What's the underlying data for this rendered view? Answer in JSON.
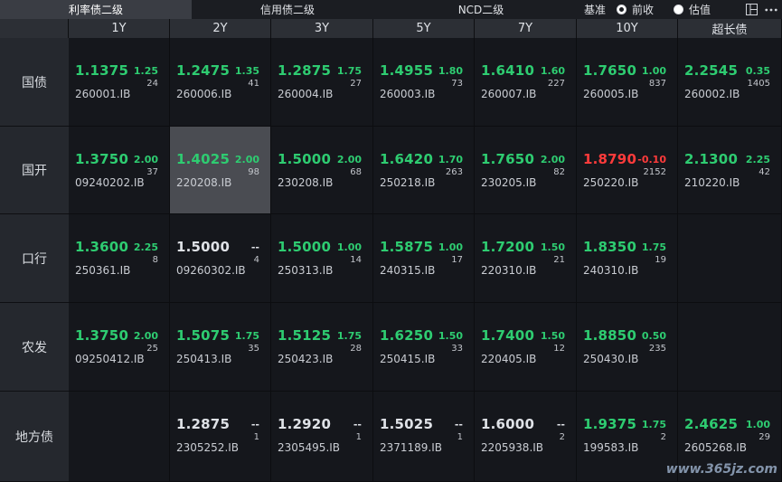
{
  "tabs": [
    {
      "label": "利率债二级",
      "active": true
    },
    {
      "label": "信用债二级",
      "active": false
    },
    {
      "label": "NCD二级",
      "active": false
    }
  ],
  "controls": {
    "base_label": "基准",
    "options": [
      {
        "label": "前收",
        "checked": true
      },
      {
        "label": "估值",
        "checked": false
      }
    ],
    "icons": [
      "layout-icon",
      "more-icon"
    ]
  },
  "columns": [
    "1Y",
    "2Y",
    "3Y",
    "5Y",
    "7Y",
    "10Y",
    "超长债"
  ],
  "rows": [
    {
      "label": "国债",
      "cells": [
        {
          "val": "1.1375",
          "chg": "1.25",
          "vol": "24",
          "code": "260001.IB",
          "color": "green"
        },
        {
          "val": "1.2475",
          "chg": "1.35",
          "vol": "41",
          "code": "260006.IB",
          "color": "green"
        },
        {
          "val": "1.2875",
          "chg": "1.75",
          "vol": "27",
          "code": "260004.IB",
          "color": "green"
        },
        {
          "val": "1.4955",
          "chg": "1.80",
          "vol": "73",
          "code": "260003.IB",
          "color": "green"
        },
        {
          "val": "1.6410",
          "chg": "1.60",
          "vol": "227",
          "code": "260007.IB",
          "color": "green"
        },
        {
          "val": "1.7650",
          "chg": "1.00",
          "vol": "837",
          "code": "260005.IB",
          "color": "green"
        },
        {
          "val": "2.2545",
          "chg": "0.35",
          "vol": "1405",
          "code": "260002.IB",
          "color": "green"
        }
      ]
    },
    {
      "label": "国开",
      "cells": [
        {
          "val": "1.3750",
          "chg": "2.00",
          "vol": "37",
          "code": "09240202.IB",
          "color": "green"
        },
        {
          "val": "1.4025",
          "chg": "2.00",
          "vol": "98",
          "code": "220208.IB",
          "color": "green",
          "selected": true
        },
        {
          "val": "1.5000",
          "chg": "2.00",
          "vol": "68",
          "code": "230208.IB",
          "color": "green"
        },
        {
          "val": "1.6420",
          "chg": "1.70",
          "vol": "263",
          "code": "250218.IB",
          "color": "green"
        },
        {
          "val": "1.7650",
          "chg": "2.00",
          "vol": "82",
          "code": "230205.IB",
          "color": "green"
        },
        {
          "val": "1.8790",
          "chg": "-0.10",
          "vol": "2152",
          "code": "250220.IB",
          "color": "red"
        },
        {
          "val": "2.1300",
          "chg": "2.25",
          "vol": "42",
          "code": "210220.IB",
          "color": "green"
        }
      ]
    },
    {
      "label": "口行",
      "cells": [
        {
          "val": "1.3600",
          "chg": "2.25",
          "vol": "8",
          "code": "250361.IB",
          "color": "green"
        },
        {
          "val": "1.5000",
          "chg": "--",
          "vol": "4",
          "code": "09260302.IB",
          "color": "white"
        },
        {
          "val": "1.5000",
          "chg": "1.00",
          "vol": "14",
          "code": "250313.IB",
          "color": "green"
        },
        {
          "val": "1.5875",
          "chg": "1.00",
          "vol": "17",
          "code": "240315.IB",
          "color": "green"
        },
        {
          "val": "1.7200",
          "chg": "1.50",
          "vol": "21",
          "code": "220310.IB",
          "color": "green"
        },
        {
          "val": "1.8350",
          "chg": "1.75",
          "vol": "19",
          "code": "240310.IB",
          "color": "green"
        },
        null
      ]
    },
    {
      "label": "农发",
      "cells": [
        {
          "val": "1.3750",
          "chg": "2.00",
          "vol": "25",
          "code": "09250412.IB",
          "color": "green"
        },
        {
          "val": "1.5075",
          "chg": "1.75",
          "vol": "35",
          "code": "250413.IB",
          "color": "green"
        },
        {
          "val": "1.5125",
          "chg": "1.75",
          "vol": "28",
          "code": "250423.IB",
          "color": "green"
        },
        {
          "val": "1.6250",
          "chg": "1.50",
          "vol": "33",
          "code": "250415.IB",
          "color": "green"
        },
        {
          "val": "1.7400",
          "chg": "1.50",
          "vol": "12",
          "code": "220405.IB",
          "color": "green"
        },
        {
          "val": "1.8850",
          "chg": "0.50",
          "vol": "235",
          "code": "250430.IB",
          "color": "green"
        },
        null
      ]
    },
    {
      "label": "地方债",
      "cells": [
        null,
        {
          "val": "1.2875",
          "chg": "--",
          "vol": "1",
          "code": "2305252.IB",
          "color": "white"
        },
        {
          "val": "1.2920",
          "chg": "--",
          "vol": "1",
          "code": "2305495.IB",
          "color": "white"
        },
        {
          "val": "1.5025",
          "chg": "--",
          "vol": "1",
          "code": "2371189.IB",
          "color": "white"
        },
        {
          "val": "1.6000",
          "chg": "--",
          "vol": "2",
          "code": "2205938.IB",
          "color": "white"
        },
        {
          "val": "1.9375",
          "chg": "1.75",
          "vol": "2",
          "code": "199583.IB",
          "color": "green"
        },
        {
          "val": "2.4625",
          "chg": "1.00",
          "vol": "29",
          "code": "2605268.IB",
          "color": "green"
        }
      ]
    }
  ],
  "watermark": "www.365jz.com"
}
